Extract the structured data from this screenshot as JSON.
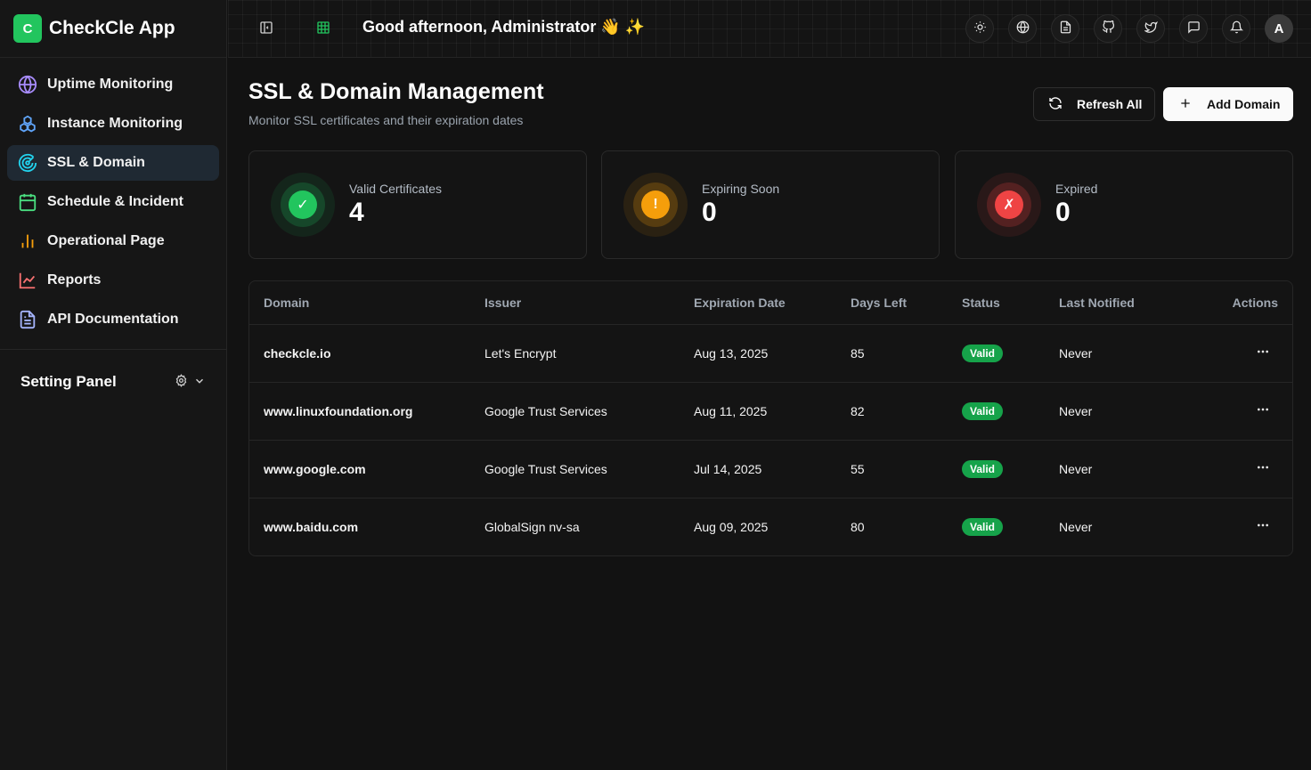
{
  "app": {
    "logo_letter": "C",
    "name": "CheckCle App"
  },
  "sidebar": {
    "items": [
      {
        "label": "Uptime Monitoring",
        "icon": "globe-icon",
        "color": "#a78bfa"
      },
      {
        "label": "Instance Monitoring",
        "icon": "boxes-icon",
        "color": "#60a5fa"
      },
      {
        "label": "SSL & Domain",
        "icon": "radar-icon",
        "color": "#22d3ee"
      },
      {
        "label": "Schedule & Incident",
        "icon": "calendar-icon",
        "color": "#4ade80"
      },
      {
        "label": "Operational Page",
        "icon": "bar-chart-icon",
        "color": "#f59e0b"
      },
      {
        "label": "Reports",
        "icon": "line-chart-icon",
        "color": "#f87171"
      },
      {
        "label": "API Documentation",
        "icon": "file-text-icon",
        "color": "#a5b4fc"
      }
    ],
    "active_index": 2,
    "setting_panel": "Setting Panel"
  },
  "header": {
    "greeting": "Good afternoon, Administrator 👋 ✨",
    "avatar": "A"
  },
  "page": {
    "title": "SSL & Domain Management",
    "subtitle": "Monitor SSL certificates and their expiration dates",
    "refresh_label": "Refresh All",
    "add_label": "Add Domain"
  },
  "stats": [
    {
      "label": "Valid Certificates",
      "value": "4",
      "glyph": "✓",
      "color": "#22c55e"
    },
    {
      "label": "Expiring Soon",
      "value": "0",
      "glyph": "!",
      "color": "#f59e0b"
    },
    {
      "label": "Expired",
      "value": "0",
      "glyph": "✗",
      "color": "#ef4444"
    }
  ],
  "table": {
    "columns": [
      "Domain",
      "Issuer",
      "Expiration Date",
      "Days Left",
      "Status",
      "Last Notified",
      "Actions"
    ],
    "rows": [
      {
        "domain": "checkcle.io",
        "issuer": "Let's Encrypt",
        "expiration": "Aug 13, 2025",
        "days_left": "85",
        "status": "Valid",
        "last_notified": "Never"
      },
      {
        "domain": "www.linuxfoundation.org",
        "issuer": "Google Trust Services",
        "expiration": "Aug 11, 2025",
        "days_left": "82",
        "status": "Valid",
        "last_notified": "Never"
      },
      {
        "domain": "www.google.com",
        "issuer": "Google Trust Services",
        "expiration": "Jul 14, 2025",
        "days_left": "55",
        "status": "Valid",
        "last_notified": "Never"
      },
      {
        "domain": "www.baidu.com",
        "issuer": "GlobalSign nv-sa",
        "expiration": "Aug 09, 2025",
        "days_left": "80",
        "status": "Valid",
        "last_notified": "Never"
      }
    ]
  }
}
